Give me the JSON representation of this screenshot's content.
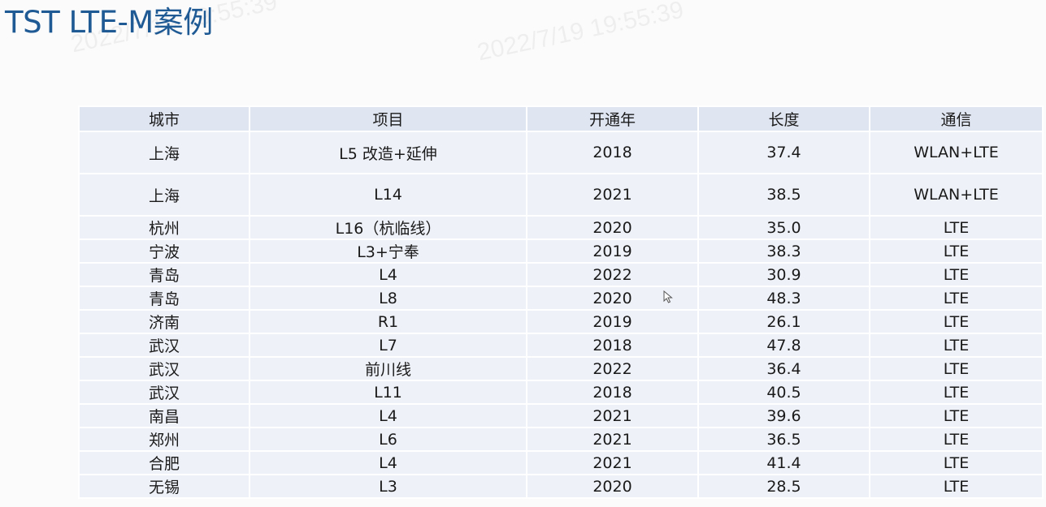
{
  "slide": {
    "title": "TST LTE-M案例",
    "watermark_text": "2022/7/19 19:55:39"
  },
  "table": {
    "headers": [
      "城市",
      "项目",
      "开通年",
      "长度",
      "通信"
    ],
    "rows": [
      {
        "city": "上海",
        "project": "L5 改造+延伸",
        "year": "2018",
        "length": "37.4",
        "comm": "WLAN+LTE"
      },
      {
        "city": "上海",
        "project": "L14",
        "year": "2021",
        "length": "38.5",
        "comm": "WLAN+LTE"
      },
      {
        "city": "杭州",
        "project": "L16（杭临线）",
        "year": "2020",
        "length": "35.0",
        "comm": "LTE"
      },
      {
        "city": "宁波",
        "project": "L3+宁奉",
        "year": "2019",
        "length": "38.3",
        "comm": "LTE"
      },
      {
        "city": "青岛",
        "project": "L4",
        "year": "2022",
        "length": "30.9",
        "comm": "LTE"
      },
      {
        "city": "青岛",
        "project": "L8",
        "year": "2020",
        "length": "48.3",
        "comm": "LTE"
      },
      {
        "city": "济南",
        "project": "R1",
        "year": "2019",
        "length": "26.1",
        "comm": "LTE"
      },
      {
        "city": "武汉",
        "project": "L7",
        "year": "2018",
        "length": "47.8",
        "comm": "LTE"
      },
      {
        "city": "武汉",
        "project": "前川线",
        "year": "2022",
        "length": "36.4",
        "comm": "LTE"
      },
      {
        "city": "武汉",
        "project": "L11",
        "year": "2018",
        "length": "40.5",
        "comm": "LTE"
      },
      {
        "city": "南昌",
        "project": "L4",
        "year": "2021",
        "length": "39.6",
        "comm": "LTE"
      },
      {
        "city": "郑州",
        "project": "L6",
        "year": "2021",
        "length": "36.5",
        "comm": "LTE"
      },
      {
        "city": "合肥",
        "project": "L4",
        "year": "2021",
        "length": "41.4",
        "comm": "LTE"
      },
      {
        "city": "无锡",
        "project": "L3",
        "year": "2020",
        "length": "28.5",
        "comm": "LTE"
      }
    ]
  },
  "colors": {
    "title": "#1f5a95",
    "header_bg": "#dfe5f1",
    "row_bg": "#eef1f8"
  },
  "icons": {
    "cursor": "mouse-pointer-icon"
  }
}
